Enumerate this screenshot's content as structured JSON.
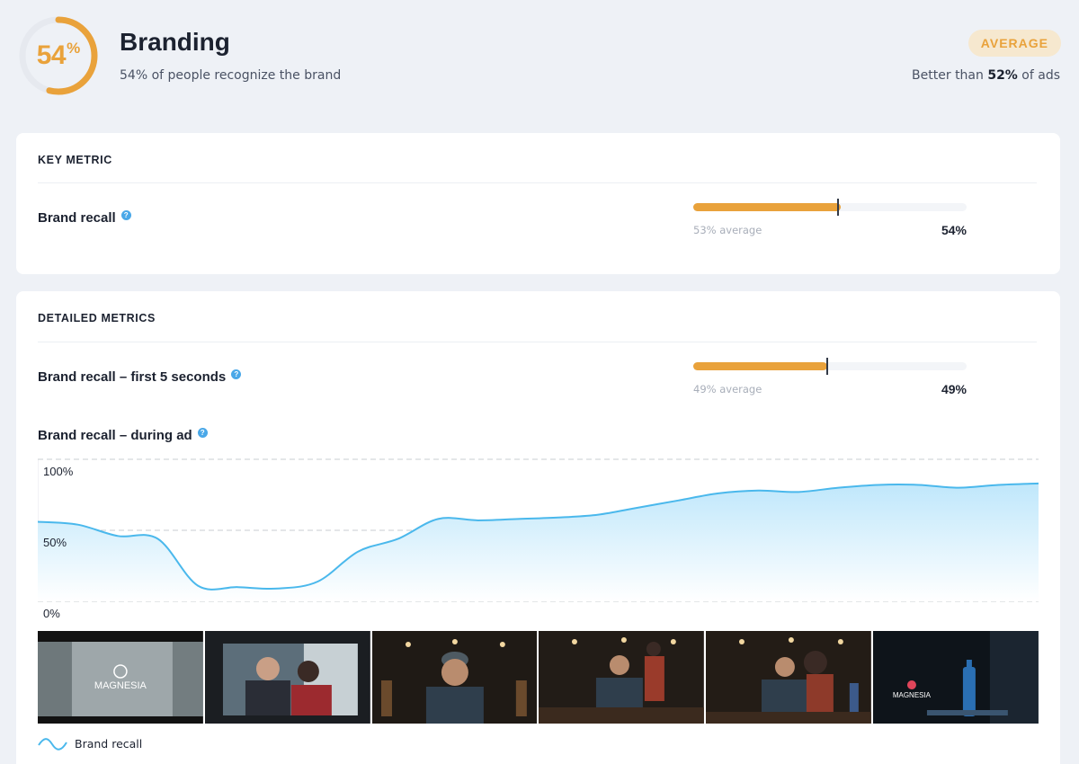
{
  "header": {
    "score_value": "54",
    "score_unit": "%",
    "score_fraction": 0.54,
    "title": "Branding",
    "subtitle": "54% of people recognize the brand",
    "badge": "AVERAGE",
    "better_prefix": "Better than ",
    "better_value": "52%",
    "better_suffix": " of ads"
  },
  "key_metric": {
    "heading": "KEY METRIC",
    "label": "Brand recall",
    "help_icon": "question-circle-icon",
    "value_label": "54%",
    "value": 54,
    "average": 53,
    "average_label": "53% average"
  },
  "detailed": {
    "heading": "DETAILED METRICS",
    "first5": {
      "label": "Brand recall – first 5 seconds",
      "value_label": "49%",
      "value": 49,
      "average": 49,
      "average_label": "49% average"
    },
    "during_ad": {
      "label": "Brand recall – during ad"
    },
    "legend": "Brand recall"
  },
  "colors": {
    "accent": "#e9a23b",
    "line": "#4ab8ec",
    "area": "#c9eafb",
    "help": "#4aa8e8"
  },
  "chart_data": {
    "type": "area",
    "ylim": [
      0,
      100
    ],
    "yticks": [
      "100%",
      "50%",
      "0%"
    ],
    "grid": true,
    "series": [
      {
        "name": "Brand recall",
        "x": [
          0,
          4,
          8,
          12,
          16,
          20,
          24,
          28,
          32,
          36,
          40,
          44,
          48,
          52,
          56,
          60,
          64,
          68,
          72,
          76,
          80,
          84,
          88,
          92,
          96,
          100
        ],
        "values": [
          56,
          54,
          46,
          44,
          11,
          10,
          9,
          14,
          35,
          44,
          58,
          57,
          58,
          59,
          61,
          66,
          71,
          76,
          78,
          77,
          80,
          82,
          82,
          80,
          82,
          83
        ]
      }
    ]
  },
  "thumbnails": [
    {
      "name": "thumbnail-1",
      "text": "MAGNESIA",
      "scene": "street"
    },
    {
      "name": "thumbnail-2",
      "text": "",
      "scene": "couple"
    },
    {
      "name": "thumbnail-3",
      "text": "",
      "scene": "man-closeup"
    },
    {
      "name": "thumbnail-4",
      "text": "",
      "scene": "man-woman-behind"
    },
    {
      "name": "thumbnail-5",
      "text": "",
      "scene": "man-woman-bottle"
    },
    {
      "name": "thumbnail-6",
      "text": "MAGNESIA",
      "scene": "bottle"
    }
  ]
}
